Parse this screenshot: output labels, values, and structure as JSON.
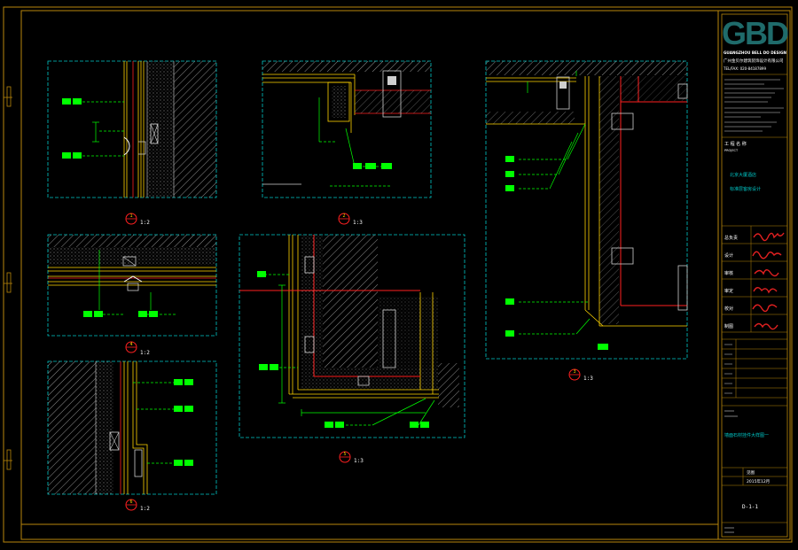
{
  "colors": {
    "background": "#000000",
    "frame": "#b8860b",
    "viewport": "#00c8c8",
    "construction": "#ffd400",
    "section": "#ff2020",
    "annotation": "#00ff00",
    "text": "#ffffff",
    "logo": "#1f6b6b"
  },
  "title_block": {
    "logo_text": "GBD",
    "firm_en": "GUANGZHOU BELL DO DESIGN",
    "firm_cn": "广州金贝尔建筑装饰设计有限公司",
    "tel": "TEL/FAX: 020-84187899",
    "project_label": "工 程 名 称",
    "project_sub": "PROJECT",
    "project_name_1": "北京大厦酒店",
    "project_name_2": "标准层客房设计",
    "signatures": [
      {
        "label": "总负责",
        "mark": "孙小明"
      },
      {
        "label": "设计",
        "mark": "王小红"
      },
      {
        "label": "审核",
        "mark": "李四"
      },
      {
        "label": "审定",
        "mark": "赵六"
      },
      {
        "label": "校对",
        "mark": "陈七"
      },
      {
        "label": "制图",
        "mark": "刘八"
      }
    ],
    "drawing_title": "墙面石材挂件大样图一",
    "scale": "见图",
    "date": "2015年12月",
    "drawing_no": "D-1-1"
  },
  "details": [
    {
      "id": "d1",
      "number": "1",
      "scale": "1:2"
    },
    {
      "id": "d2",
      "number": "2",
      "scale": "1:3"
    },
    {
      "id": "d3",
      "number": "3",
      "scale": "1:3"
    },
    {
      "id": "d4",
      "number": "4",
      "scale": "1:2"
    },
    {
      "id": "d5",
      "number": "5",
      "scale": "1:3"
    },
    {
      "id": "d6",
      "number": "6",
      "scale": "1:2"
    }
  ]
}
